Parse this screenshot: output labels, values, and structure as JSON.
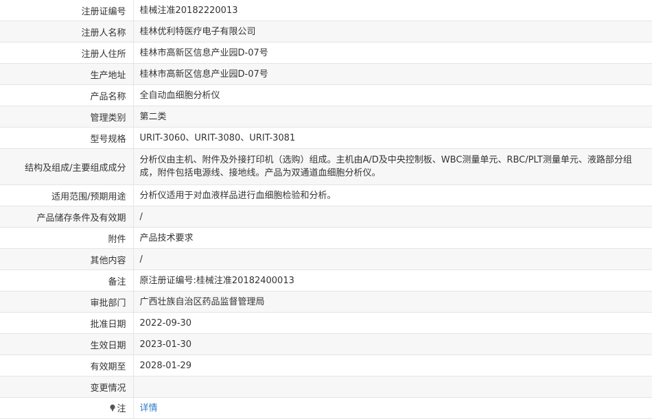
{
  "rows": [
    {
      "label": "注册证编号",
      "value": "桂械注准20182220013"
    },
    {
      "label": "注册人名称",
      "value": "桂林优利特医疗电子有限公司"
    },
    {
      "label": "注册人住所",
      "value": "桂林市高新区信息产业园D-07号"
    },
    {
      "label": "生产地址",
      "value": "桂林市高新区信息产业园D-07号"
    },
    {
      "label": "产品名称",
      "value": "全自动血细胞分析仪"
    },
    {
      "label": "管理类别",
      "value": "第二类"
    },
    {
      "label": "型号规格",
      "value": "URIT-3060、URIT-3080、URIT-3081"
    },
    {
      "label": "结构及组成/主要组成成分",
      "value": "分析仪由主机、附件及外接打印机（选购）组成。主机由A/D及中央控制板、WBC测量单元、RBC/PLT测量单元、液路部分组成，附件包括电源线、接地线。产品为双通道血细胞分析仪。"
    },
    {
      "label": "适用范围/预期用途",
      "value": "分析仪适用于对血液样品进行血细胞检验和分析。"
    },
    {
      "label": "产品储存条件及有效期",
      "value": "/"
    },
    {
      "label": "附件",
      "value": "产品技术要求"
    },
    {
      "label": "其他内容",
      "value": "/"
    },
    {
      "label": "备注",
      "value": "原注册证编号:桂械注准20182400013"
    },
    {
      "label": "审批部门",
      "value": "广西壮族自治区药品监督管理局"
    },
    {
      "label": "批准日期",
      "value": "2022-09-30"
    },
    {
      "label": "生效日期",
      "value": "2023-01-30"
    },
    {
      "label": "有效期至",
      "value": "2028-01-29"
    },
    {
      "label": "变更情况",
      "value": ""
    }
  ],
  "note": {
    "label": "注",
    "link_text": "详情",
    "icon": "pin-icon"
  }
}
